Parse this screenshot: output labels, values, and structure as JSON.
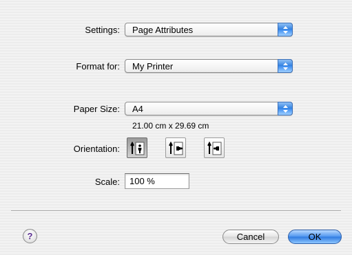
{
  "settings": {
    "label": "Settings:",
    "value": "Page Attributes"
  },
  "format_for": {
    "label": "Format for:",
    "value": "My Printer"
  },
  "paper_size": {
    "label": "Paper Size:",
    "value": "A4",
    "dimensions": "21.00 cm x 29.69 cm"
  },
  "orientation": {
    "label": "Orientation:",
    "options": [
      {
        "icon": "portrait-orientation-icon",
        "selected": true
      },
      {
        "icon": "landscape-left-orientation-icon",
        "selected": false
      },
      {
        "icon": "landscape-right-orientation-icon",
        "selected": false
      }
    ]
  },
  "scale": {
    "label": "Scale:",
    "value": "100 %"
  },
  "buttons": {
    "help": "?",
    "cancel": "Cancel",
    "ok": "OK"
  },
  "colors": {
    "accent": "#3c8cf0",
    "help_glyph": "#5a2d91"
  }
}
